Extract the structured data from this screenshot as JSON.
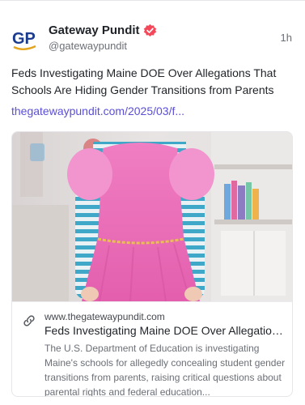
{
  "author": {
    "name": "Gateway Pundit",
    "handle": "@gatewaypundit",
    "avatar_text": "GP",
    "verified_color": "#f4485a"
  },
  "post": {
    "time": "1h",
    "text": "Feds Investigating Maine DOE Over Allegations That Schools Are Hiding Gender Transitions from Parents",
    "link": "thegatewaypundit.com/2025/03/f..."
  },
  "preview": {
    "image_alt": "child in pink dress over striped shirt",
    "domain": "www.thegatewaypundit.com",
    "title": "Feds Investigating Maine DOE Over Allegations...",
    "description": "The U.S. Department of Education is investigating Maine's schools for allegedly concealing student gender transitions from parents, raising critical questions about parental rights and federal education..."
  },
  "colors": {
    "link": "#5b4fd8",
    "brand_blue": "#1b3b8f",
    "brand_gold": "#e4a51c"
  }
}
